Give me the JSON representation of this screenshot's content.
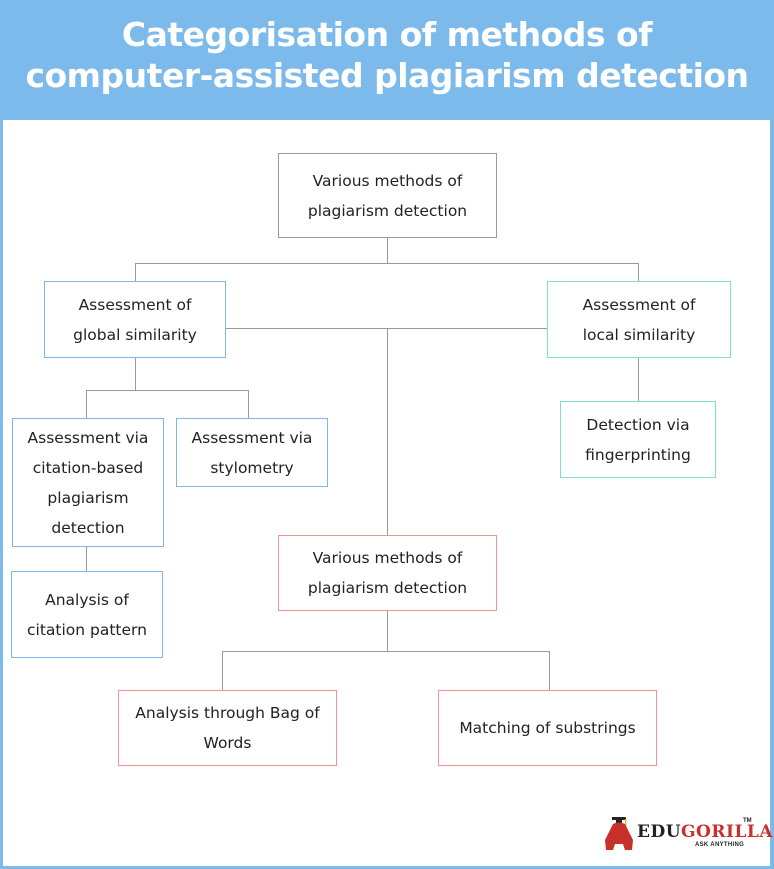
{
  "title": {
    "line1": "Categorisation of methods of",
    "line2": "computer-assisted plagiarism detection"
  },
  "nodes": {
    "root": "Various methods of plagiarism detection",
    "global": "Assessment of global similarity",
    "local": "Assessment of local similarity",
    "citation_based": "Assessment via citation-based plagiarism detection",
    "stylometry": "Assessment via stylometry",
    "citation_pattern": "Analysis of citation pattern",
    "fingerprinting": "Detection via fingerprinting",
    "methods_second": "Various methods of plagiarism detection",
    "bag_of_words": "Analysis through Bag of Words",
    "substrings": "Matching of substrings"
  },
  "colors": {
    "header": "#7dbaec",
    "root_border": "#9a9a9a",
    "global_border": "#7db6e8",
    "local_border": "#7fe0cc",
    "text_border": "#ef9494",
    "connector": "#9a9a9a"
  },
  "logo": {
    "brand_part1": "EDU",
    "brand_part2": "GORILLA",
    "trademark": "TM",
    "tagline": "ASK ANYTHING"
  }
}
